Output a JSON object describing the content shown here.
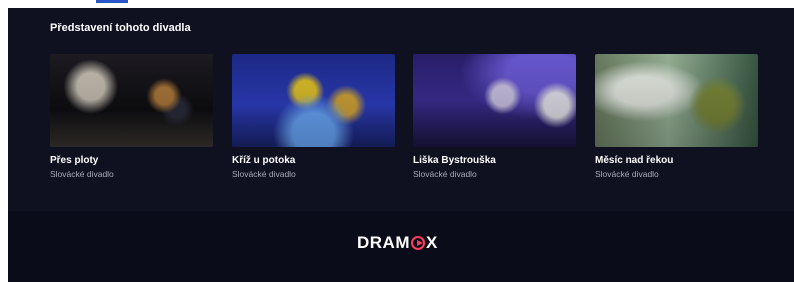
{
  "section": {
    "title": "Představení tohoto divadla",
    "cards": [
      {
        "title": "Přes ploty",
        "subtitle": "Slovácké divadlo",
        "thumb_icon": "stage-photo"
      },
      {
        "title": "Kříž u potoka",
        "subtitle": "Slovácké divadlo",
        "thumb_icon": "stage-photo"
      },
      {
        "title": "Liška Bystrouška",
        "subtitle": "Slovácké divadlo",
        "thumb_icon": "stage-photo"
      },
      {
        "title": "Měsíc nad řekou",
        "subtitle": "Slovácké divadlo",
        "thumb_icon": "stage-photo"
      }
    ]
  },
  "footer": {
    "logo_left": "DRAM",
    "logo_right": "X",
    "logo_icon": "play-circle-icon",
    "accent_color": "#ff3d5a"
  }
}
